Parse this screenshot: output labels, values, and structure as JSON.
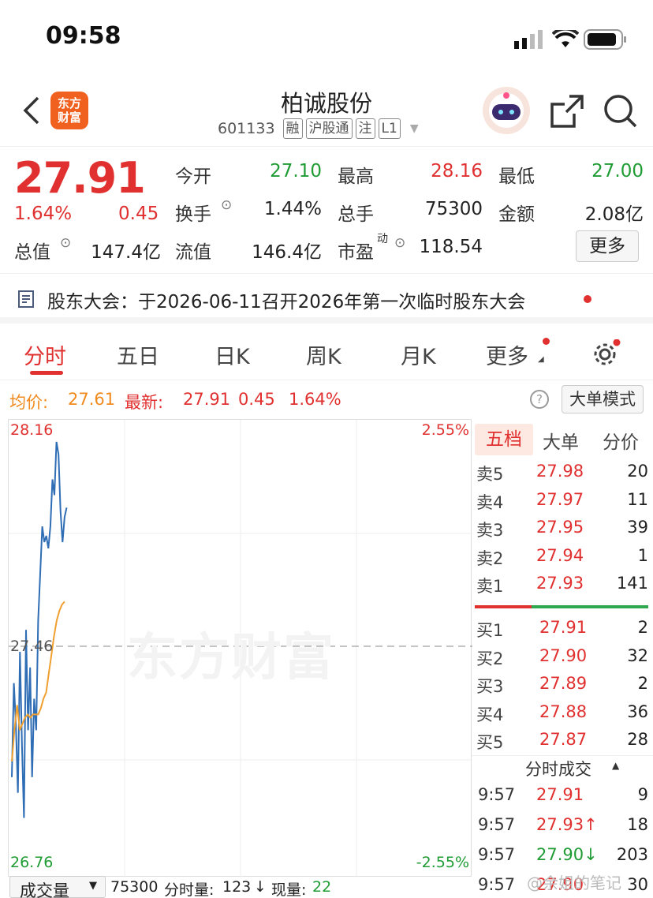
{
  "status": {
    "time": "09:58"
  },
  "header": {
    "title": "柏诚股份",
    "code": "601133",
    "tags": [
      "融",
      "沪股通",
      "注",
      "L1"
    ],
    "logo_text_1": "东方",
    "logo_text_2": "财富"
  },
  "quote": {
    "price": "27.91",
    "change_pct": "1.64%",
    "change": "0.45",
    "open_label": "今开",
    "open": "27.10",
    "high_label": "最高",
    "high": "28.16",
    "low_label": "最低",
    "low": "27.00",
    "turnover_label": "换手",
    "turnover": "1.44%",
    "volume_label": "总手",
    "volume": "75300",
    "amount_label": "金额",
    "amount": "2.08亿",
    "mcap_label": "总值",
    "mcap": "147.4亿",
    "float_label": "流值",
    "float": "146.4亿",
    "pe_label": "市盈",
    "pe_sup": "动",
    "pe": "118.54",
    "more_button": "更多"
  },
  "notice": {
    "text": "股东大会：于2026-06-11召开2026年第一次临时股东大会"
  },
  "tabs": [
    "分时",
    "五日",
    "日K",
    "周K",
    "月K",
    "更多"
  ],
  "infobar": {
    "avg_label": "均价:",
    "avg": "27.61",
    "latest_label": "最新:",
    "latest": "27.91",
    "change": "0.45",
    "change_pct": "1.64%",
    "mode_button": "大单模式"
  },
  "chart_data": {
    "type": "line",
    "title": "",
    "y_top_label": "28.16",
    "y_mid_label": "27.46",
    "y_bottom_label": "26.76",
    "pct_top_label": "2.55%",
    "pct_bottom_label": "-2.55%",
    "watermark": "东方财富",
    "ylim": [
      26.76,
      28.16
    ],
    "reference_price": 27.46,
    "series": [
      {
        "values": [
          27.05,
          27.35,
          27.22,
          27.0,
          27.45,
          27.15,
          26.92,
          27.52,
          27.2,
          27.4,
          27.05,
          27.3,
          27.2,
          27.55,
          27.7,
          27.85,
          27.8,
          27.82,
          27.78,
          27.85,
          28.0,
          27.95,
          28.12,
          28.08,
          27.9,
          27.8,
          27.88,
          27.91
        ]
      },
      {
        "values": [
          27.1,
          27.2,
          27.28,
          27.2,
          27.22,
          27.24,
          27.25,
          27.24,
          27.25,
          27.25,
          27.25,
          27.27,
          27.3,
          27.32,
          27.38,
          27.44,
          27.5,
          27.55,
          27.58,
          27.6,
          27.61
        ]
      }
    ]
  },
  "bottombar": {
    "dropdown": "成交量",
    "volume": "75300",
    "period_label": "分时量:",
    "period_vol": "123",
    "current_label": "现量:",
    "current_vol": "22"
  },
  "orderbook": {
    "tabs": [
      "五档",
      "大单",
      "分价"
    ],
    "asks": [
      {
        "label": "卖5",
        "price": "27.98",
        "qty": "20"
      },
      {
        "label": "卖4",
        "price": "27.97",
        "qty": "11"
      },
      {
        "label": "卖3",
        "price": "27.95",
        "qty": "39"
      },
      {
        "label": "卖2",
        "price": "27.94",
        "qty": "1"
      },
      {
        "label": "卖1",
        "price": "27.93",
        "qty": "141"
      }
    ],
    "bids": [
      {
        "label": "买1",
        "price": "27.91",
        "qty": "2"
      },
      {
        "label": "买2",
        "price": "27.90",
        "qty": "32"
      },
      {
        "label": "买3",
        "price": "27.89",
        "qty": "2"
      },
      {
        "label": "买4",
        "price": "27.88",
        "qty": "36"
      },
      {
        "label": "买5",
        "price": "27.87",
        "qty": "28"
      }
    ],
    "trades_title": "分时成交",
    "trades": [
      {
        "time": "9:57",
        "price": "27.91",
        "qty": "9"
      },
      {
        "time": "9:57",
        "price": "27.93↑",
        "qty": "18"
      },
      {
        "time": "9:57",
        "price": "27.90↓",
        "qty": "203"
      },
      {
        "time": "9:57",
        "price": "27.90",
        "qty": "30"
      }
    ],
    "watermark": "@余姐的笔记"
  }
}
